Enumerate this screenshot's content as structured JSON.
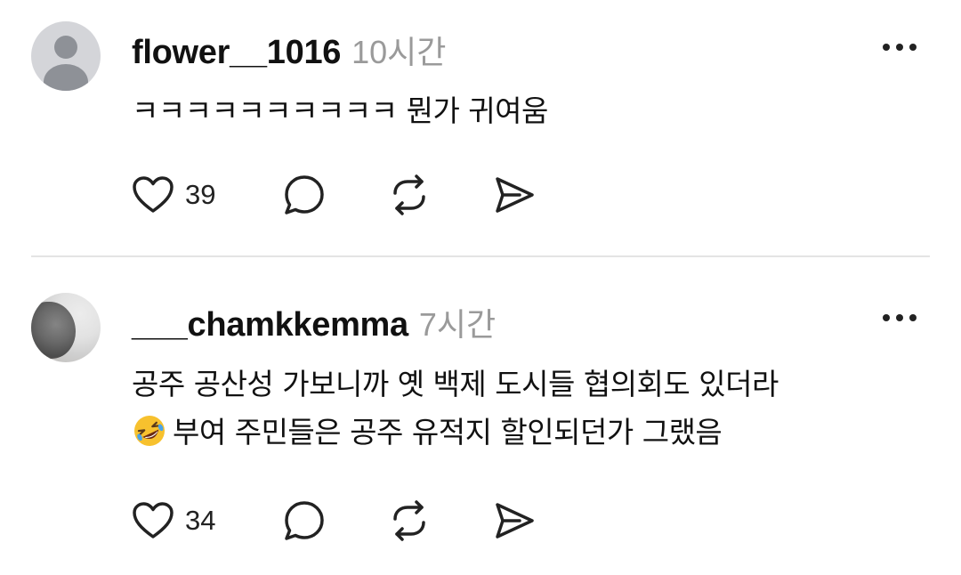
{
  "posts": [
    {
      "username": "flower__1016",
      "time": "10시간",
      "text_lines": [
        "ㅋㅋㅋㅋㅋㅋㅋㅋㅋㅋ 뭔가 귀여움"
      ],
      "likes": "39",
      "avatar": "default-avatar"
    },
    {
      "username": "___chamkkemma",
      "time": "7시간",
      "text_lines": [
        "공주 공산성 가보니까 옛 백제 도시들 협의회도 있더라",
        "부여 주민들은 공주 유적지 할인되던가 그랬음"
      ],
      "emoji": "rolling-on-floor-laughing",
      "likes": "34",
      "avatar": "photo-avatar"
    }
  ],
  "icons": {
    "like": "heart-icon",
    "reply": "comment-icon",
    "repost": "repost-icon",
    "share": "send-icon",
    "more": "more-icon"
  },
  "colors": {
    "text": "#111111",
    "muted": "#9a9a9a",
    "divider": "#e4e4e4"
  }
}
